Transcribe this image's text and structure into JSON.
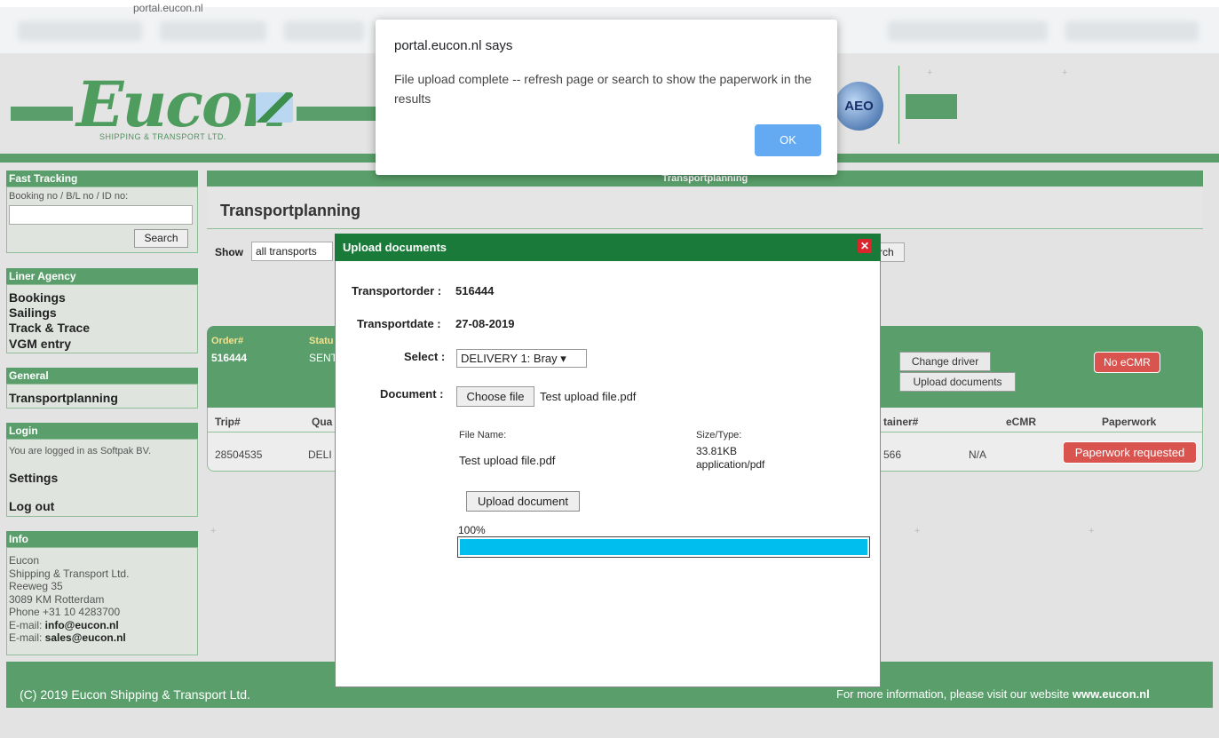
{
  "browser": {
    "url": "portal.eucon.nl"
  },
  "header": {
    "logo_text": "Eucon",
    "logo_subtitle": "SHIPPING & TRANSPORT LTD.",
    "aeo_badge": "AEO"
  },
  "sidebar": {
    "fast_tracking": {
      "title": "Fast Tracking",
      "label": "Booking no / B/L no / ID no:",
      "search_label": "Search"
    },
    "liner_agency": {
      "title": "Liner Agency",
      "items": [
        "Bookings",
        "Sailings",
        "Track & Trace",
        "VGM entry"
      ]
    },
    "general": {
      "title": "General",
      "items": [
        "Transportplanning"
      ]
    },
    "login": {
      "title": "Login",
      "logged_in_text": "You are logged in as Softpak BV.",
      "settings": "Settings",
      "logout": "Log out"
    },
    "info": {
      "title": "Info",
      "lines": [
        "Eucon",
        "Shipping & Transport Ltd.",
        "Reeweg 35",
        "3089 KM Rotterdam",
        "Phone +31 10 4283700"
      ],
      "email_prefix": "E-mail: ",
      "email1": "info@eucon.nl",
      "email2": "sales@eucon.nl"
    }
  },
  "main": {
    "section_title": "Transportplanning",
    "heading": "Transportplanning",
    "show_label": "Show",
    "show_select": "all transports",
    "search_partial": "rch",
    "order": {
      "order_label": "Order#",
      "order_value": "516444",
      "status_label": "Statu",
      "status_value": "SENT"
    },
    "buttons": {
      "change_driver": "Change driver",
      "upload_documents": "Upload documents",
      "no_ecmr": "No eCMR"
    },
    "table": {
      "headers": {
        "trip": "Trip#",
        "qua": "Qua",
        "container": "tainer#",
        "ecmr": "eCMR",
        "paperwork": "Paperwork"
      },
      "row": {
        "trip": "28504535",
        "qua": "DELI",
        "container": "566",
        "ecmr": "N/A",
        "paperwork": "Paperwork requested"
      }
    }
  },
  "footer": {
    "copyright": "(C) 2019 Eucon Shipping & Transport Ltd.",
    "info_prefix": "For more information, please visit our website ",
    "website": "www.eucon.nl"
  },
  "upload_dialog": {
    "title": "Upload documents",
    "transportorder_label": "Transportorder :",
    "transportorder_value": "516444",
    "transportdate_label": "Transportdate :",
    "transportdate_value": "27-08-2019",
    "select_label": "Select :",
    "select_value": "DELIVERY 1: Bray",
    "document_label": "Document :",
    "choose_file_label": "Choose file",
    "chosen_file": "Test upload file.pdf",
    "file_name_header": "File Name:",
    "size_type_header": "Size/Type:",
    "file_name": "Test upload file.pdf",
    "file_size": "33.81KB",
    "file_type": "application/pdf",
    "upload_button": "Upload document",
    "progress_text": "100%",
    "progress": 1.0
  },
  "alert": {
    "title": "portal.eucon.nl says",
    "message": "File upload complete -- refresh page or search to show the paperwork in the results",
    "ok_label": "OK"
  },
  "colors": {
    "brand_green": "#5a9f6b",
    "dialog_green": "#1a7a3a",
    "alert_button": "#63aaf2",
    "progress_fill": "#00bfef",
    "danger": "#d9534f"
  }
}
